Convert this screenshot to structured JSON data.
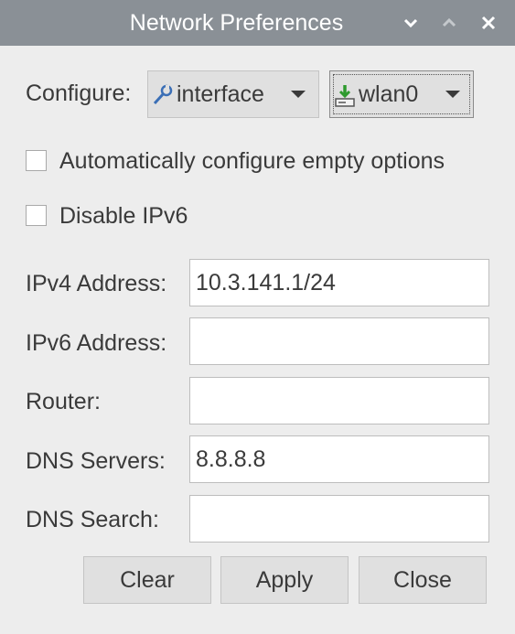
{
  "window": {
    "title": "Network Preferences",
    "titlebar_color": "#8a9096",
    "controls": {
      "minimize_icon": "chevron-down-icon",
      "maximize_icon": "chevron-up-icon",
      "close_icon": "close-icon"
    }
  },
  "configure": {
    "label": "Configure:",
    "type_combo": {
      "value": "interface",
      "icon": "wrench-icon"
    },
    "device_combo": {
      "value": "wlan0",
      "icon": "network-device-icon"
    }
  },
  "options": {
    "auto_configure": {
      "label": "Automatically configure empty options",
      "checked": false
    },
    "disable_ipv6": {
      "label": "Disable IPv6",
      "checked": false
    }
  },
  "fields": {
    "ipv4": {
      "label": "IPv4 Address:",
      "value": "10.3.141.1/24"
    },
    "ipv6": {
      "label": "IPv6 Address:",
      "value": ""
    },
    "router": {
      "label": "Router:",
      "value": ""
    },
    "dns_servers": {
      "label": "DNS Servers:",
      "value": "8.8.8.8"
    },
    "dns_search": {
      "label": "DNS Search:",
      "value": ""
    }
  },
  "buttons": {
    "clear": "Clear",
    "apply": "Apply",
    "close": "Close"
  }
}
